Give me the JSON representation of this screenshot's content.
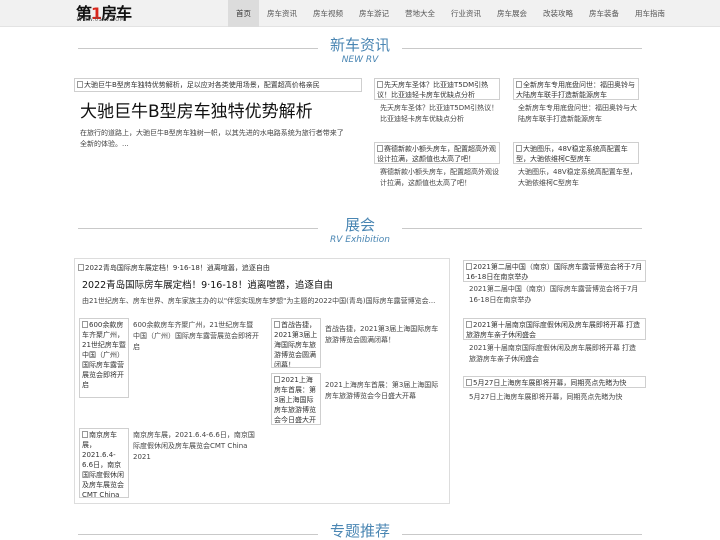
{
  "header": {
    "logo": {
      "main_a": "第",
      "main_b": "1",
      "main_c": "房车",
      "url": "WWW.01RV.COM"
    },
    "nav": [
      "首页",
      "房车资讯",
      "房车视频",
      "房车游记",
      "营地大全",
      "行业资讯",
      "房车展会",
      "改装攻略",
      "房车装备",
      "用车指南"
    ]
  },
  "news": {
    "title_cn": "新车资讯",
    "title_en": "NEW RV",
    "lead_img": "大驰巨牛B型房车独特优势解析，足以应对各类使用场景，配置超高价格亲民",
    "lead_title": "大驰巨牛B型房车独特优势解析",
    "lead_desc": "在旅行的道路上，大驰巨牛B型房车独树一帜，以其先进的水电路系统为旅行者带来了全新的体验。...",
    "cards": [
      {
        "img": "先天房车圣体？比亚迪T5DM引热议！比亚迪轻卡房车优缺点分析",
        "text": "先天房车圣体？比亚迪T5DM引热议！比亚迪轻卡房车优缺点分析"
      },
      {
        "img": "全新房车专用底盘问世：福田奥铃与大陆房车联手打造新能源房车",
        "text": "全新房车专用底盘问世：福田奥铃与大陆房车联手打造新能源房车"
      },
      {
        "img": "赛德新款小额头房车，配置超高外观设计拉满，这颜值也太高了吧！",
        "text": "赛德新款小额头房车，配置超高外观设计拉满，这颜值也太高了吧！"
      },
      {
        "img": "大驰图乐，48V稳定系统高配置车型，大驰依维柯C型房车",
        "text": "大驰图乐，48V稳定系统高配置车型，大驰依维柯C型房车"
      }
    ]
  },
  "expo": {
    "title_cn": "展会",
    "title_en": "RV Exhibition",
    "lead_img": "2022青岛国际房车展定档！9·16-18！逍离喧嚣，追逐自由",
    "lead_title": "2022青岛国际房车展定档！9·16-18！逍离喧嚣，追逐自由",
    "lead_desc": "由21世纪房车、房车世界、房车家族主办的以\"伴您实现房车梦想\"为主题的2022中国(青岛)国际房车露营博览会...",
    "items": [
      {
        "img": "600余款房车齐聚广州，21世纪房车暨中国（广州）国际房车露营展览会即将开启",
        "text": "600余款房车齐聚广州，21世纪房车暨中国（广州）国际房车露营展览会即将开启"
      },
      {
        "img": "首战告捷，2021第3届上海国际房车旅游博览会圆满闭幕！",
        "text": "首战告捷，2021第3届上海国际房车旅游博览会圆满闭幕！"
      },
      {
        "img": "2021上海房车首展：第3届上海国际房车旅游博览会今日盛大开幕",
        "text": "2021上海房车首展：第3届上海国际房车旅游博览会今日盛大开幕"
      },
      {
        "img": "南京房车展，2021.6.4-6.6日，南京国际度假休闲及房车展览会CMT China 2021",
        "text": "南京房车展，2021.6.4-6.6日，南京国际度假休闲及房车展览会CMT China 2021"
      }
    ],
    "side": [
      {
        "img": "2021第二届中国（南京）国际房车露营博览会将于7月16-18日在南京举办",
        "text": "2021第二届中国（南京）国际房车露营博览会将于7月16-18日在南京举办"
      },
      {
        "img": "2021第十届南京国际度假休闲及房车展即将开幕 打造旅游房车亲子休闲盛会",
        "text": "2021第十届南京国际度假休闲及房车展即将开幕 打造旅游房车亲子休闲盛会"
      },
      {
        "img": "5月27日上海房车展即将开幕，同期亮点先睹为快",
        "text": "5月27日上海房车展即将开幕，同期亮点先睹为快"
      }
    ]
  },
  "topic": {
    "title_cn": "专题推荐"
  }
}
